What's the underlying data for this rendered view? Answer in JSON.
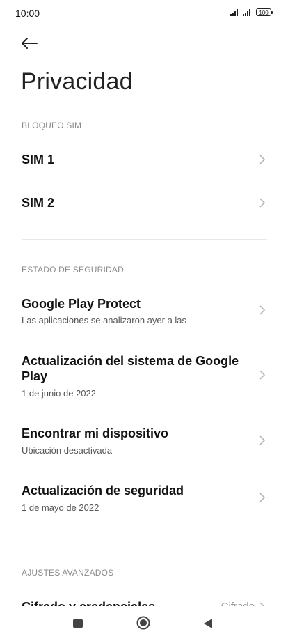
{
  "status": {
    "time": "10:00",
    "battery": "100"
  },
  "page": {
    "title": "Privacidad"
  },
  "sections": {
    "sim": {
      "header": "BLOQUEO SIM",
      "items": [
        {
          "title": "SIM 1"
        },
        {
          "title": "SIM 2"
        }
      ]
    },
    "security": {
      "header": "ESTADO DE SEGURIDAD",
      "items": [
        {
          "title": "Google Play Protect",
          "subtitle": "Las aplicaciones se analizaron ayer a las"
        },
        {
          "title_line1": "Actualización del sistema de Google",
          "title_line2": "Play",
          "subtitle": "1 de junio de 2022"
        },
        {
          "title": "Encontrar mi dispositivo",
          "subtitle": "Ubicación desactivada"
        },
        {
          "title": "Actualización de seguridad",
          "subtitle": "1 de mayo de 2022"
        }
      ]
    },
    "advanced": {
      "header": "AJUSTES AVANZADOS",
      "items": [
        {
          "title": "Cifrado y credenciales",
          "value": "Cifrado"
        }
      ]
    }
  },
  "icons": {
    "back": "arrow-left-icon",
    "chevron": "chevron-right-icon",
    "nav_recents": "square-icon",
    "nav_home": "circle-icon",
    "nav_back": "triangle-back-icon"
  }
}
